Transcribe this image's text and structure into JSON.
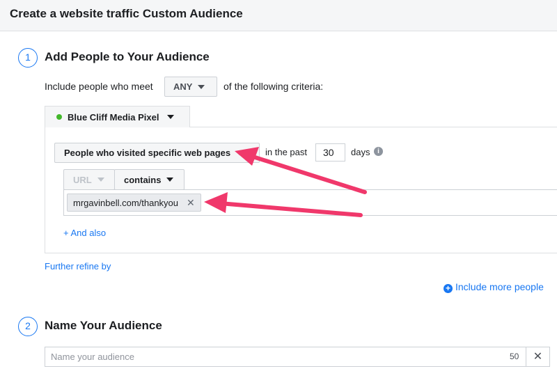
{
  "header": {
    "title": "Create a website traffic Custom Audience"
  },
  "step1": {
    "number": "1",
    "title": "Add People to Your Audience",
    "include_prefix": "Include people who meet",
    "match_value": "ANY",
    "include_suffix": "of the following criteria:",
    "pixel_tab": "Blue Cliff Media Pixel",
    "rule_type": "People who visited specific web pages",
    "in_the_past": "in the past",
    "days_value": "30",
    "days_label": "days",
    "info_icon": "i",
    "url_field": "URL",
    "operator": "contains",
    "url_token": "mrgavinbell.com/thankyou",
    "token_remove": "✕",
    "and_also": "+ And also",
    "further_refine": "Further refine by",
    "include_more": "Include more people"
  },
  "step2": {
    "number": "2",
    "title": "Name Your Audience",
    "name_placeholder": "Name your audience",
    "char_limit": "50",
    "clear": "✕"
  },
  "colors": {
    "accent": "#1877f2",
    "pixel_status": "#42b72a",
    "annotation_arrow": "#f0386b"
  },
  "icons": {
    "info": "info-icon",
    "dropdown": "caret-down-icon",
    "remove": "close-icon",
    "add": "plus-circle-icon"
  }
}
